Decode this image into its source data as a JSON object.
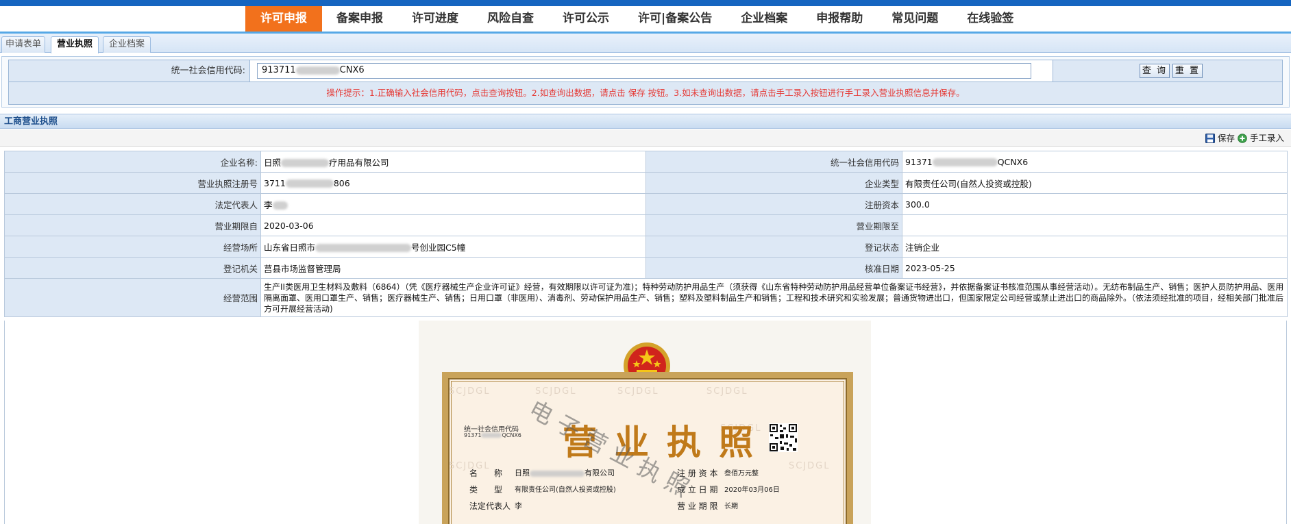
{
  "nav": {
    "items": [
      {
        "label": "许可申报",
        "active": true
      },
      {
        "label": "备案申报"
      },
      {
        "label": "许可进度"
      },
      {
        "label": "风险自查"
      },
      {
        "label": "许可公示"
      },
      {
        "label": "许可|备案公告"
      },
      {
        "label": "企业档案"
      },
      {
        "label": "申报帮助"
      },
      {
        "label": "常见问题"
      },
      {
        "label": "在线验签"
      }
    ]
  },
  "subtabs": {
    "items": [
      {
        "label": "申请表单"
      },
      {
        "label": "营业执照",
        "active": true
      },
      {
        "label": "企业档案"
      }
    ]
  },
  "query": {
    "label": "统一社会信用代码:",
    "value_prefix": "913711",
    "value_suffix": "CNX6",
    "search_label": "查 询",
    "reset_label": "重 置",
    "tip": "操作提示：1.正确输入社会信用代码，点击查询按钮。2.如查询出数据，请点击 保存 按钮。3.如未查询出数据，请点击手工录入按钮进行手工录入营业执照信息并保存。"
  },
  "section": {
    "title": "工商营业执照"
  },
  "toolbar": {
    "save_label": "保存",
    "manual_label": "手工录入"
  },
  "info": {
    "company_name_label": "企业名称:",
    "company_name_prefix": "日照",
    "company_name_suffix": "疗用品有限公司",
    "credit_code_label": "统一社会信用代码",
    "credit_code_prefix": "91371",
    "credit_code_suffix": "QCNX6",
    "reg_no_label": "营业执照注册号",
    "reg_no_prefix": "3711",
    "reg_no_suffix": "806",
    "company_type_label": "企业类型",
    "company_type": "有限责任公司(自然人投资或控股)",
    "legal_rep_label": "法定代表人",
    "legal_rep_prefix": "李",
    "reg_capital_label": "注册资本",
    "reg_capital": "300.0",
    "period_from_label": "营业期限自",
    "period_from": "2020-03-06",
    "period_to_label": "营业期限至",
    "period_to": "",
    "address_label": "经营场所",
    "address_prefix": "山东省日照市",
    "address_suffix": "号创业园C5幢",
    "reg_status_label": "登记状态",
    "reg_status": "注销企业",
    "authority_label": "登记机关",
    "authority": "莒县市场监督管理局",
    "approve_date_label": "核准日期",
    "approve_date": "2023-05-25",
    "scope_label": "经营范围",
    "scope": "生产II类医用卫生材料及敷料（6864）（凭《医疗器械生产企业许可证》经营，有效期限以许可证为准)；特种劳动防护用品生产（须获得《山东省特种劳动防护用品经营单位备案证书经营》，并依据备案证书核准范围从事经营活动）。无纺布制品生产、销售；医护人员防护用品、医用隔离面罩、医用口罩生产、销售；医疗器械生产、销售；日用口罩（非医用）、消毒剂、劳动保护用品生产、销售；塑料及塑料制品生产和销售；工程和技术研究和实验发展；普通货物进出口，但国家限定公司经营或禁止进出口的商品除外。（依法须经批准的项目，经相关部门批准后方可开展经营活动)"
  },
  "license_image": {
    "title": "营业执照",
    "credit_code_caption": "统一社会信用代码",
    "code_fragment": "91371",
    "code_tail": "QCNX6",
    "name_label": "名　　称",
    "name_value_prefix": "日照",
    "name_value_suffix": "有限公司",
    "type_label": "类　　型",
    "type_value": "有限责任公司(自然人投资或控股)",
    "legal_label": "法定代表人",
    "legal_value": "李",
    "capital_label": "注 册 资 本",
    "capital_value": "叁佰万元整",
    "found_label": "成 立 日 期",
    "found_value": "2020年03月06日",
    "term_label": "营 业 期 限",
    "term_value": "长期",
    "watermark": "SCJDGL",
    "diag_text": "电 子 营 业 执 照"
  },
  "colors": {
    "nav_active": "#f2711c",
    "top_strip": "#1565c0",
    "tip_red": "#e53935",
    "license_title": "#c07a1a"
  }
}
